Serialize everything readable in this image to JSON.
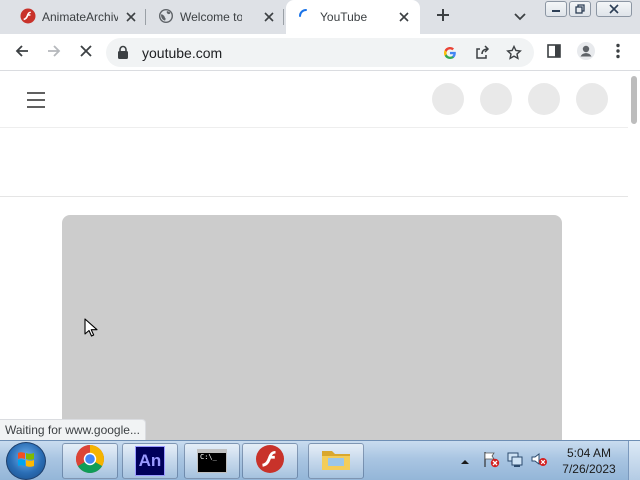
{
  "browser": {
    "tabs": [
      {
        "title": "AnimateArchive",
        "favicon": "flash-icon",
        "active": false
      },
      {
        "title": "Welcome to Flashpoint",
        "favicon": "globe-icon",
        "active": false
      },
      {
        "title": "YouTube",
        "favicon": "loading-spinner-icon",
        "active": true
      }
    ],
    "address_bar": {
      "url": "youtube.com",
      "secure_icon": "lock-icon"
    },
    "toolbar_icons": [
      "back-icon",
      "forward-icon",
      "stop-loading-icon",
      "google-icon",
      "share-icon",
      "bookmark-star-icon",
      "side-panel-icon",
      "profile-icon",
      "menu-dots-icon"
    ],
    "status_text": "Waiting for www.google..."
  },
  "taskbar": {
    "apps": [
      "chrome-icon",
      "animate-icon",
      "cmd-icon",
      "flash-player-icon",
      "explorer-icon"
    ],
    "animate_label": "An",
    "cmd_label": "C:\\_",
    "clock": {
      "time": "5:04 AM",
      "date": "7/26/2023"
    }
  },
  "colors": {
    "tabstrip": "#dee1e6",
    "omnibox": "#f1f3f4",
    "skeleton": "#cccccc",
    "taskbar": "#a9c5e2"
  }
}
